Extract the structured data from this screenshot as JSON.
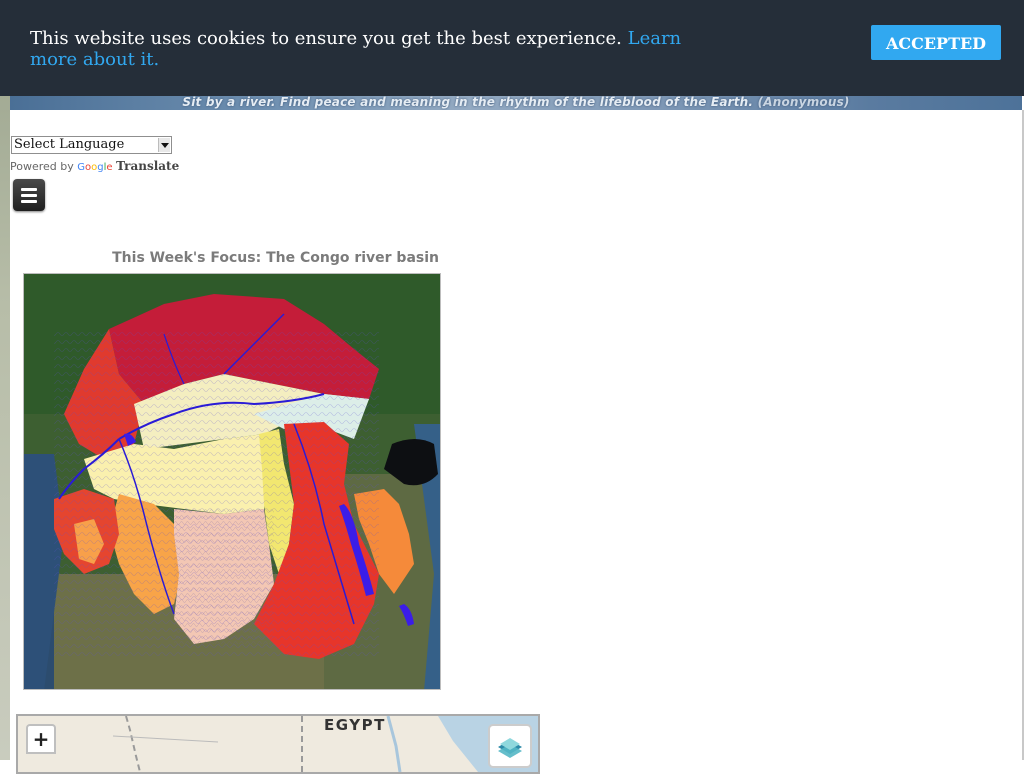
{
  "cookie_bar": {
    "message": "This website uses cookies to ensure you get the best experience.",
    "learn_more": "Learn more about it.",
    "accept_label": "ACCEPTED",
    "background": "#252e39",
    "accent": "#31a8f0"
  },
  "banner": {
    "quote": "Sit by a river. Find peace and meaning in the rhythm of the lifeblood of the Earth.",
    "author": "(Anonymous)"
  },
  "translate": {
    "select_value": "Select Language",
    "powered_by": "Powered by",
    "google": "Google",
    "translate_word": "Translate"
  },
  "menu": {
    "icon": "hamburger-icon"
  },
  "focus": {
    "title": "This Week's Focus: The Congo river basin"
  },
  "africa_map": {
    "label": "EGYPT",
    "zoom_in_label": "+",
    "layers_icon": "layers-icon"
  }
}
